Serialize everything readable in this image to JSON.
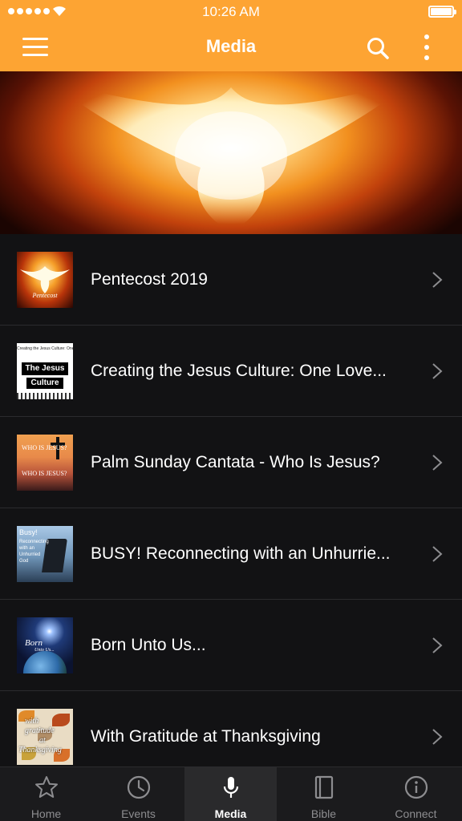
{
  "status_bar": {
    "time": "10:26 AM"
  },
  "header": {
    "title": "Media",
    "icons": [
      "menu-icon",
      "search-icon",
      "more-vertical-icon"
    ]
  },
  "hero": {
    "image": "glowing-dove-image"
  },
  "media_items": [
    {
      "title": "Pentecost 2019",
      "thumb_caption": "Pentecost"
    },
    {
      "title": "Creating the Jesus Culture: One Love...",
      "thumb_top": "Creating the Jesus Culture: One love at a time",
      "thumb_line1": "The Jesus",
      "thumb_line2": "Culture"
    },
    {
      "title": "Palm Sunday Cantata - Who Is Jesus?",
      "thumb_line1": "WHO IS JESUS?",
      "thumb_line2": "WHO IS JESUS?"
    },
    {
      "title": "BUSY! Reconnecting with an Unhurrie...",
      "thumb_line1": "Busy!",
      "thumb_line2": "Reconnecting",
      "thumb_line3": "with an",
      "thumb_line4": "Unhurried",
      "thumb_line5": "God"
    },
    {
      "title": "Born Unto Us...",
      "thumb_line1": "Born",
      "thumb_line2": "Unto Us..."
    },
    {
      "title": "With Gratitude at Thanksgiving",
      "thumb_line1": "with",
      "thumb_line2": "gratitude",
      "thumb_line3": "at",
      "thumb_line4": "Thanksgiving"
    }
  ],
  "tabs": [
    {
      "label": "Home",
      "icon": "star-icon",
      "active": false
    },
    {
      "label": "Events",
      "icon": "clock-icon",
      "active": false
    },
    {
      "label": "Media",
      "icon": "microphone-icon",
      "active": true
    },
    {
      "label": "Bible",
      "icon": "book-icon",
      "active": false
    },
    {
      "label": "Connect",
      "icon": "info-icon",
      "active": false
    }
  ],
  "colors": {
    "header_bg": "#fda433",
    "list_bg": "#121214",
    "tabbar_bg": "#1b1b1d",
    "tab_active": "#ffffff",
    "tab_inactive": "#8d8d90"
  }
}
